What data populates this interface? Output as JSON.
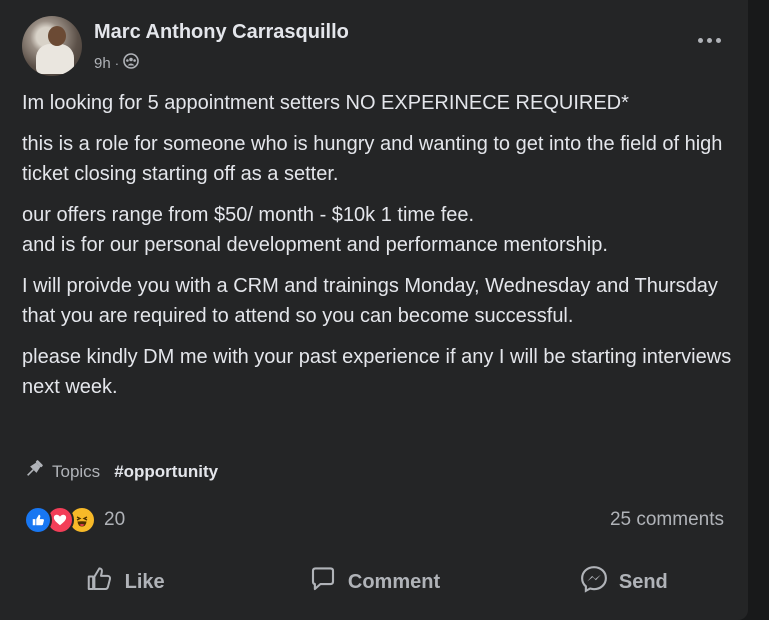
{
  "post": {
    "author": "Marc Anthony Carrasquillo",
    "time": "9h",
    "separator": "·",
    "audience_icon": "group-audience-icon",
    "paragraphs": [
      "Im looking for 5 appointment setters NO EXPERINECE REQUIRED*",
      "this is a role for someone who is hungry and wanting to get into the field of high ticket closing starting off as a setter.",
      "our offers range from $50/ month - $10k 1 time fee.\nand is for our personal development and performance mentorship.",
      "I will proivde you with a CRM and trainings Monday, Wednesday and Thursday that you are required to attend so you can become successful.",
      "please kindly DM me with your past experience if any I will be starting interviews next week."
    ],
    "topics_label": "Topics",
    "topic_tag": "#opportunity",
    "reaction_count": "20",
    "comments_count": "25 comments"
  },
  "actions": {
    "like": "Like",
    "comment": "Comment",
    "send": "Send"
  },
  "colors": {
    "background": "#18191a",
    "card": "#242526",
    "text": "#e4e6eb",
    "secondary": "#b0b3b8",
    "like": "#1877f2",
    "love": "#f33e58",
    "haha": "#f7b928"
  }
}
